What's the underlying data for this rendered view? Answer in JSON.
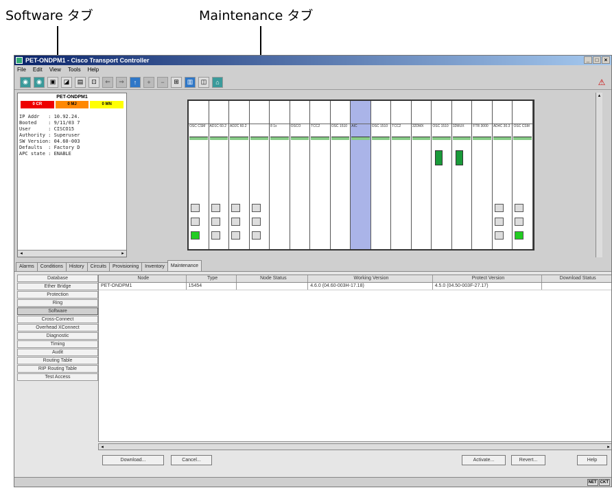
{
  "callouts": {
    "software_tab": "Software タブ",
    "maintenance_tab": "Maintenance タブ"
  },
  "window": {
    "title": "PET-ONDPM1 - Cisco Transport Controller",
    "menu": [
      "File",
      "Edit",
      "View",
      "Tools",
      "Help"
    ]
  },
  "node_panel": {
    "name": "PET-ONDPM1",
    "alarms": {
      "critical": "0 CR",
      "major": "0 MJ",
      "minor": "0 MN"
    },
    "info": [
      "IP Addr   : 10.92.24.",
      "Booted    : 9/11/03 7",
      "User      : CISCO15",
      "Authority : Superuser",
      "SW Version: 04.60-003",
      "Defaults  : Factory D",
      "APC state : ENABLE"
    ]
  },
  "shelf_cards": [
    "OSC CSM",
    "AD1C 60.2",
    "AD2C 60.2",
    "",
    "8 1x",
    "OSCO",
    "TCC2",
    "OSC 1510",
    "AIC",
    "OSC 1510",
    "TCC2",
    "32DMX",
    "OSC 1510",
    "32MUX",
    "FTR 3000",
    "AD4C 30.3",
    "OSC CSM"
  ],
  "tabs": [
    "Alarms",
    "Conditions",
    "History",
    "Circuits",
    "Provisioning",
    "Inventory",
    "Maintenance"
  ],
  "side_buttons": [
    "Database",
    "Ether Bridge",
    "Protection",
    "Ring",
    "Software",
    "Cross-Connect",
    "Overhead XConnect",
    "Diagnostic",
    "Timing",
    "Audit",
    "Routing Table",
    "RIP Routing Table",
    "Test Access"
  ],
  "table": {
    "headers": [
      "Node",
      "Type",
      "Node Status",
      "Working Version",
      "Protect Version",
      "Download Status"
    ],
    "rows": [
      [
        "PET-ONDPM1",
        "15454",
        "",
        "4.6.0 (04.60-003H-17.18)",
        "4.5.0 (04.50-003F-27.17)",
        ""
      ]
    ]
  },
  "buttons": {
    "download": "Download...",
    "cancel": "Cancel...",
    "activate": "Activate...",
    "revert": "Revert...",
    "help": "Help"
  },
  "status": {
    "net": "NET",
    "ckt": "CKT"
  }
}
